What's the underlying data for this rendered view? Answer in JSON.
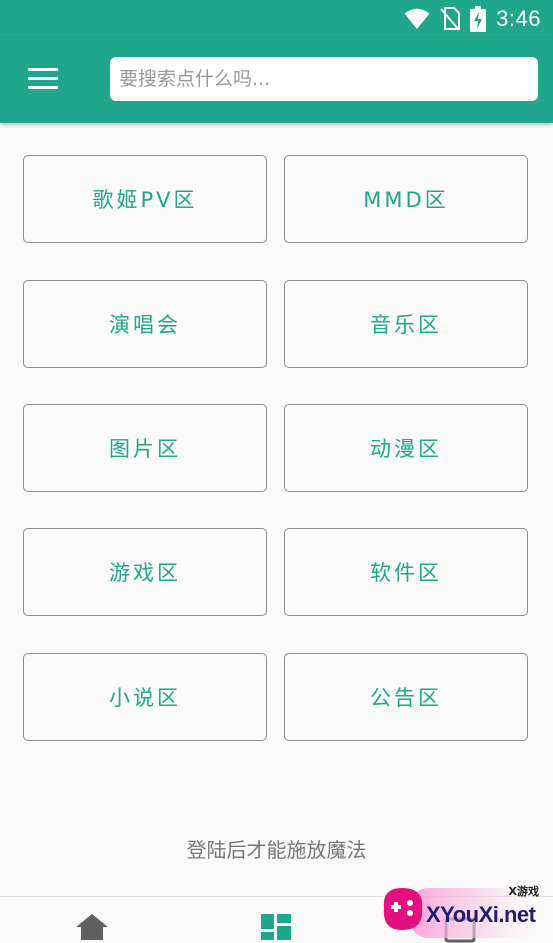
{
  "status_bar": {
    "time": "3:46",
    "icons": [
      "wifi-icon",
      "no-sim-icon",
      "battery-charging-icon"
    ]
  },
  "app_bar": {
    "menu_icon": "hamburger-menu-icon",
    "search_placeholder": "要搜索点什么吗...",
    "search_value": ""
  },
  "categories": [
    "歌姬PV区",
    "MMD区",
    "演唱会",
    "音乐区",
    "图片区",
    "动漫区",
    "游戏区",
    "软件区",
    "小说区",
    "公告区"
  ],
  "login_message": "登陆后才能施放魔法",
  "bottom_nav": {
    "items": [
      "home-icon",
      "dashboard-icon",
      "profile-icon"
    ]
  },
  "watermark": {
    "text": "XYouXi.net",
    "small_text": "X游戏"
  },
  "colors": {
    "primary": "#20a68a",
    "background": "#fafafa",
    "tile_border": "#8e8e8e",
    "text_muted": "#777777"
  }
}
